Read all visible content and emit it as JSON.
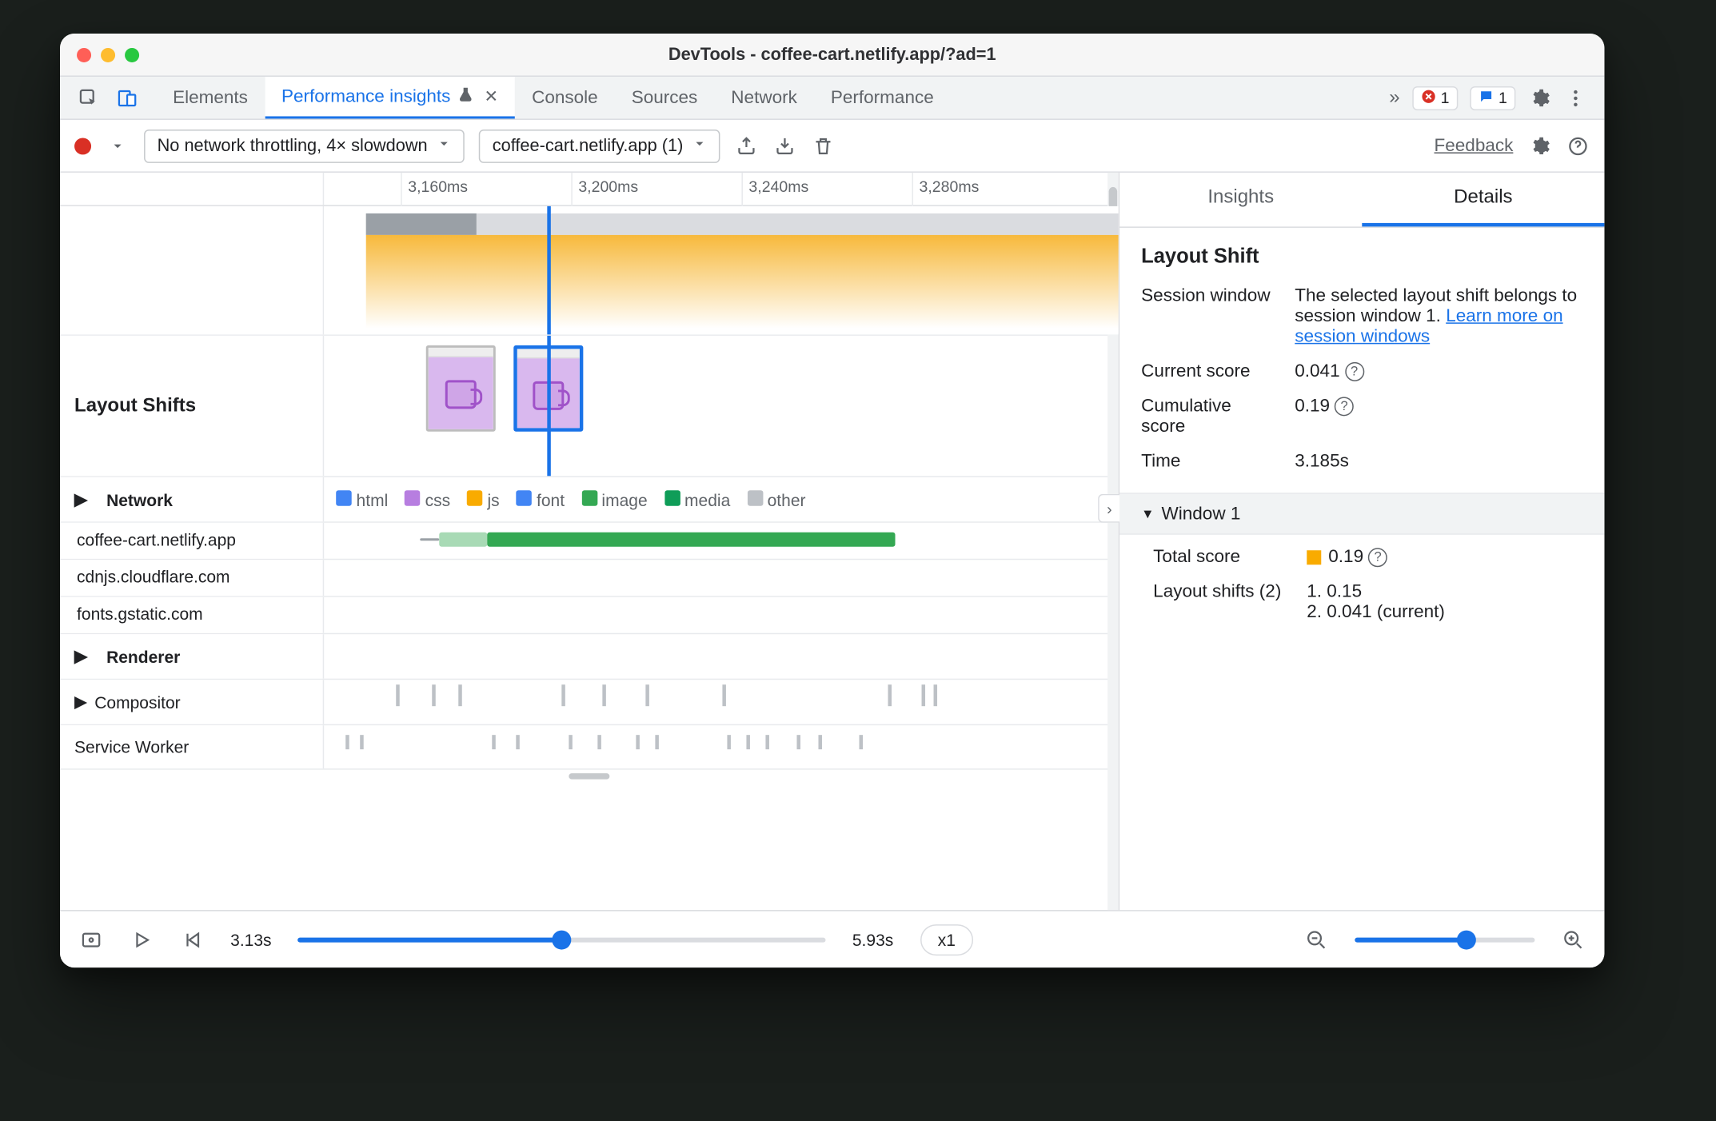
{
  "window": {
    "title": "DevTools - coffee-cart.netlify.app/?ad=1"
  },
  "tabs": [
    "Elements",
    "Performance insights",
    "Console",
    "Sources",
    "Network",
    "Performance"
  ],
  "badges": {
    "errors": "1",
    "messages": "1"
  },
  "toolbar": {
    "throttling": "No network throttling, 4× slowdown",
    "page": "coffee-cart.netlify.app (1)",
    "feedback": "Feedback"
  },
  "ruler": [
    "3,160ms",
    "3,200ms",
    "3,240ms",
    "3,280ms"
  ],
  "tracks": {
    "layout_shifts": "Layout Shifts",
    "network": "Network",
    "renderer": "Renderer",
    "compositor": "Compositor",
    "service_worker": "Service Worker"
  },
  "legend": [
    "html",
    "css",
    "js",
    "font",
    "image",
    "media",
    "other"
  ],
  "network_hosts": [
    "coffee-cart.netlify.app",
    "cdnjs.cloudflare.com",
    "fonts.gstatic.com"
  ],
  "side": {
    "tabs": [
      "Insights",
      "Details"
    ],
    "heading": "Layout Shift",
    "kv": [
      {
        "k": "Session window",
        "v": "The selected layout shift belongs to session window 1.",
        "link": "Learn more on session windows"
      },
      {
        "k": "Current score",
        "v": "0.041"
      },
      {
        "k": "Cumulative score",
        "v": "0.19"
      },
      {
        "k": "Time",
        "v": "3.185s"
      }
    ],
    "window_label": "Window 1",
    "win": [
      {
        "k": "Total score",
        "v": "0.19"
      },
      {
        "k": "Layout shifts (2)",
        "items": [
          "1. 0.15",
          "2. 0.041 (current)"
        ]
      }
    ]
  },
  "bottom": {
    "t_start": "3.13s",
    "t_end": "5.93s",
    "speed": "x1"
  }
}
